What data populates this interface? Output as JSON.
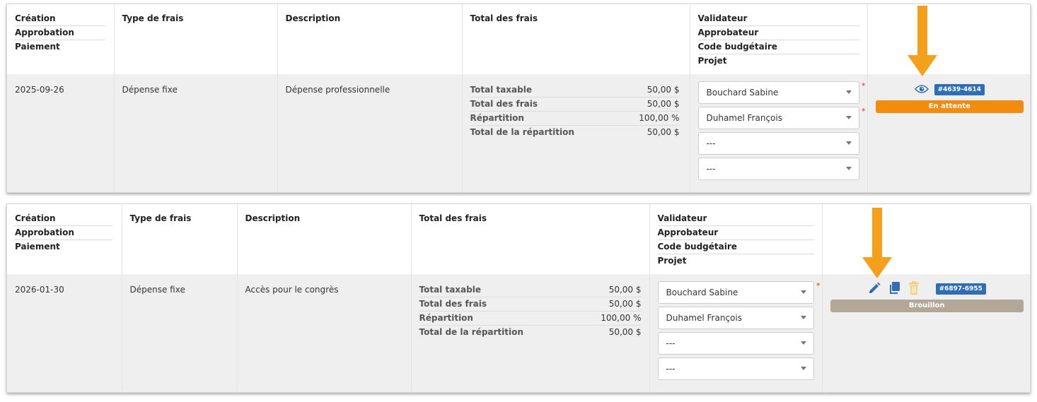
{
  "headers": {
    "creation": "Création",
    "approbation": "Approbation",
    "paiement": "Paiement",
    "type_de_frais": "Type de frais",
    "description": "Description",
    "total_des_frais": "Total des frais",
    "validateur": "Validateur",
    "approbateur": "Approbateur",
    "code_budgetaire": "Code budgétaire",
    "projet": "Projet"
  },
  "rows": [
    {
      "date": "2025-09-26",
      "type": "Dépense fixe",
      "description": "Dépense professionnelle",
      "totals": [
        {
          "label": "Total taxable",
          "value": "50,00 $"
        },
        {
          "label": "Total des frais",
          "value": "50,00 $"
        },
        {
          "label": "Répartition",
          "value": "100,00 %"
        },
        {
          "label": "Total de la répartition",
          "value": "50,00 $"
        }
      ],
      "selects": [
        "Bouchard Sabine",
        "Duhamel François",
        "---",
        "---"
      ],
      "required_mark": "*",
      "id_badge": "#4639-4614",
      "status": "En attente",
      "status_color": "#f28c0f",
      "action_icons": [
        "eye-icon"
      ]
    },
    {
      "date": "2026-01-30",
      "type": "Dépense fixe",
      "description": "Accès pour le congrès",
      "totals": [
        {
          "label": "Total taxable",
          "value": "50,00 $"
        },
        {
          "label": "Total des frais",
          "value": "50,00 $"
        },
        {
          "label": "Répartition",
          "value": "100,00 %"
        },
        {
          "label": "Total de la répartition",
          "value": "50,00 $"
        }
      ],
      "selects": [
        "Bouchard Sabine",
        "Duhamel François",
        "---",
        "---"
      ],
      "required_mark": "*",
      "id_badge": "#6897-6955",
      "status": "Brouillon",
      "status_color": "#b3a898",
      "action_icons": [
        "pencil-icon",
        "copy-icon",
        "trash-icon"
      ]
    }
  ],
  "colors": {
    "arrow": "#f5a01a",
    "badge": "#2f6db5",
    "icon_blue": "#2f6db5",
    "trash": "#f3cf7a"
  }
}
